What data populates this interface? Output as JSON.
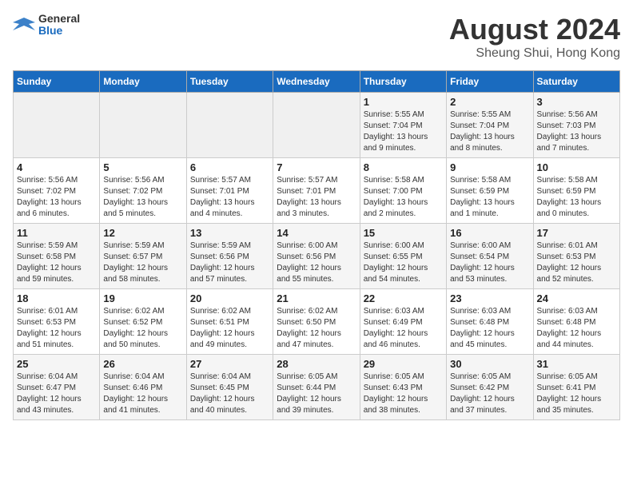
{
  "logo": {
    "general": "General",
    "blue": "Blue"
  },
  "title": "August 2024",
  "location": "Sheung Shui, Hong Kong",
  "weekdays": [
    "Sunday",
    "Monday",
    "Tuesday",
    "Wednesday",
    "Thursday",
    "Friday",
    "Saturday"
  ],
  "weeks": [
    [
      {
        "day": "",
        "detail": ""
      },
      {
        "day": "",
        "detail": ""
      },
      {
        "day": "",
        "detail": ""
      },
      {
        "day": "",
        "detail": ""
      },
      {
        "day": "1",
        "detail": "Sunrise: 5:55 AM\nSunset: 7:04 PM\nDaylight: 13 hours\nand 9 minutes."
      },
      {
        "day": "2",
        "detail": "Sunrise: 5:55 AM\nSunset: 7:04 PM\nDaylight: 13 hours\nand 8 minutes."
      },
      {
        "day": "3",
        "detail": "Sunrise: 5:56 AM\nSunset: 7:03 PM\nDaylight: 13 hours\nand 7 minutes."
      }
    ],
    [
      {
        "day": "4",
        "detail": "Sunrise: 5:56 AM\nSunset: 7:02 PM\nDaylight: 13 hours\nand 6 minutes."
      },
      {
        "day": "5",
        "detail": "Sunrise: 5:56 AM\nSunset: 7:02 PM\nDaylight: 13 hours\nand 5 minutes."
      },
      {
        "day": "6",
        "detail": "Sunrise: 5:57 AM\nSunset: 7:01 PM\nDaylight: 13 hours\nand 4 minutes."
      },
      {
        "day": "7",
        "detail": "Sunrise: 5:57 AM\nSunset: 7:01 PM\nDaylight: 13 hours\nand 3 minutes."
      },
      {
        "day": "8",
        "detail": "Sunrise: 5:58 AM\nSunset: 7:00 PM\nDaylight: 13 hours\nand 2 minutes."
      },
      {
        "day": "9",
        "detail": "Sunrise: 5:58 AM\nSunset: 6:59 PM\nDaylight: 13 hours\nand 1 minute."
      },
      {
        "day": "10",
        "detail": "Sunrise: 5:58 AM\nSunset: 6:59 PM\nDaylight: 13 hours\nand 0 minutes."
      }
    ],
    [
      {
        "day": "11",
        "detail": "Sunrise: 5:59 AM\nSunset: 6:58 PM\nDaylight: 12 hours\nand 59 minutes."
      },
      {
        "day": "12",
        "detail": "Sunrise: 5:59 AM\nSunset: 6:57 PM\nDaylight: 12 hours\nand 58 minutes."
      },
      {
        "day": "13",
        "detail": "Sunrise: 5:59 AM\nSunset: 6:56 PM\nDaylight: 12 hours\nand 57 minutes."
      },
      {
        "day": "14",
        "detail": "Sunrise: 6:00 AM\nSunset: 6:56 PM\nDaylight: 12 hours\nand 55 minutes."
      },
      {
        "day": "15",
        "detail": "Sunrise: 6:00 AM\nSunset: 6:55 PM\nDaylight: 12 hours\nand 54 minutes."
      },
      {
        "day": "16",
        "detail": "Sunrise: 6:00 AM\nSunset: 6:54 PM\nDaylight: 12 hours\nand 53 minutes."
      },
      {
        "day": "17",
        "detail": "Sunrise: 6:01 AM\nSunset: 6:53 PM\nDaylight: 12 hours\nand 52 minutes."
      }
    ],
    [
      {
        "day": "18",
        "detail": "Sunrise: 6:01 AM\nSunset: 6:53 PM\nDaylight: 12 hours\nand 51 minutes."
      },
      {
        "day": "19",
        "detail": "Sunrise: 6:02 AM\nSunset: 6:52 PM\nDaylight: 12 hours\nand 50 minutes."
      },
      {
        "day": "20",
        "detail": "Sunrise: 6:02 AM\nSunset: 6:51 PM\nDaylight: 12 hours\nand 49 minutes."
      },
      {
        "day": "21",
        "detail": "Sunrise: 6:02 AM\nSunset: 6:50 PM\nDaylight: 12 hours\nand 47 minutes."
      },
      {
        "day": "22",
        "detail": "Sunrise: 6:03 AM\nSunset: 6:49 PM\nDaylight: 12 hours\nand 46 minutes."
      },
      {
        "day": "23",
        "detail": "Sunrise: 6:03 AM\nSunset: 6:48 PM\nDaylight: 12 hours\nand 45 minutes."
      },
      {
        "day": "24",
        "detail": "Sunrise: 6:03 AM\nSunset: 6:48 PM\nDaylight: 12 hours\nand 44 minutes."
      }
    ],
    [
      {
        "day": "25",
        "detail": "Sunrise: 6:04 AM\nSunset: 6:47 PM\nDaylight: 12 hours\nand 43 minutes."
      },
      {
        "day": "26",
        "detail": "Sunrise: 6:04 AM\nSunset: 6:46 PM\nDaylight: 12 hours\nand 41 minutes."
      },
      {
        "day": "27",
        "detail": "Sunrise: 6:04 AM\nSunset: 6:45 PM\nDaylight: 12 hours\nand 40 minutes."
      },
      {
        "day": "28",
        "detail": "Sunrise: 6:05 AM\nSunset: 6:44 PM\nDaylight: 12 hours\nand 39 minutes."
      },
      {
        "day": "29",
        "detail": "Sunrise: 6:05 AM\nSunset: 6:43 PM\nDaylight: 12 hours\nand 38 minutes."
      },
      {
        "day": "30",
        "detail": "Sunrise: 6:05 AM\nSunset: 6:42 PM\nDaylight: 12 hours\nand 37 minutes."
      },
      {
        "day": "31",
        "detail": "Sunrise: 6:05 AM\nSunset: 6:41 PM\nDaylight: 12 hours\nand 35 minutes."
      }
    ]
  ]
}
